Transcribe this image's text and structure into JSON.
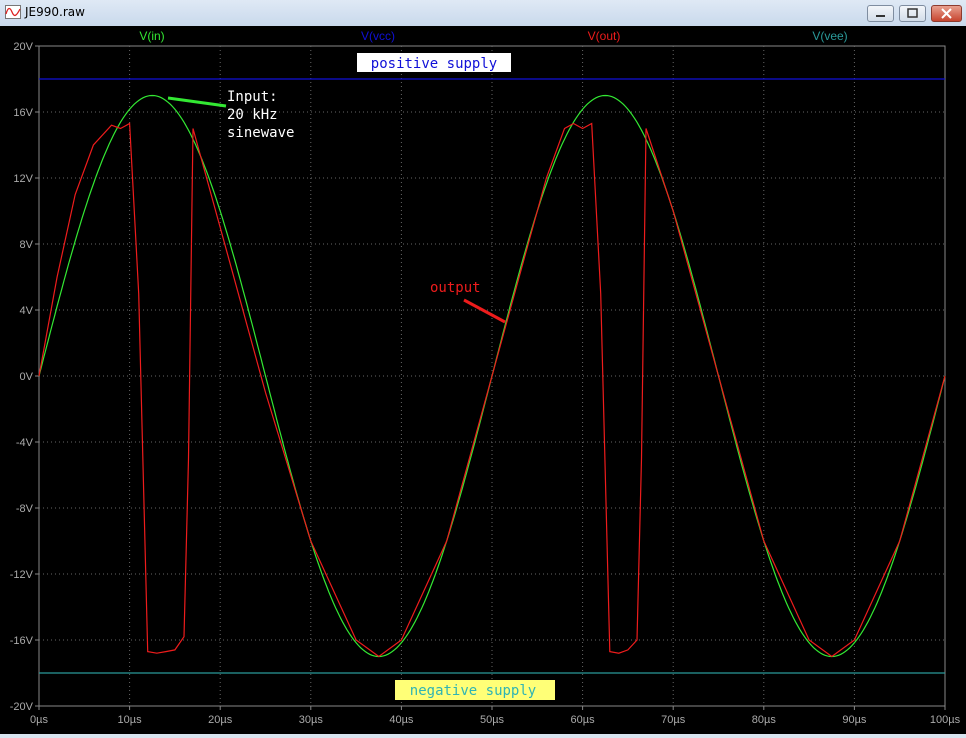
{
  "window": {
    "title": "JE990.raw"
  },
  "colors": {
    "vin": "#33e833",
    "vcc": "#1010d8",
    "vout": "#ee1c1c",
    "vee": "#2a9a9a",
    "grid": "#666666",
    "axis_text": "#aaaaaa"
  },
  "chart_data": {
    "type": "line",
    "title": "",
    "xlabel": "",
    "ylabel": "",
    "x_unit": "µs",
    "xlim": [
      0,
      100
    ],
    "ylim": [
      -20,
      20
    ],
    "x_ticks": [
      "0µs",
      "10µs",
      "20µs",
      "30µs",
      "40µs",
      "50µs",
      "60µs",
      "70µs",
      "80µs",
      "90µs",
      "100µs"
    ],
    "y_ticks": [
      "20V",
      "16V",
      "12V",
      "8V",
      "4V",
      "0V",
      "-4V",
      "-8V",
      "-12V",
      "-16V",
      "-20V"
    ],
    "grid": true,
    "legend": "top",
    "series": [
      {
        "name": "V(in)",
        "kind": "sine",
        "amplitude": 17,
        "frequency_khz": 20,
        "t_max": 100
      },
      {
        "name": "V(vcc)",
        "kind": "constant",
        "value": 18
      },
      {
        "name": "V(out)",
        "kind": "points",
        "x": [
          0,
          2,
          4,
          6,
          8,
          9,
          10,
          11,
          12,
          13,
          14,
          15,
          16,
          16.5,
          17,
          20,
          25,
          30,
          35,
          37.5,
          40,
          45,
          50,
          52,
          54,
          56,
          58,
          59,
          60,
          61,
          62,
          63,
          64,
          65,
          66,
          66.5,
          67,
          70,
          75,
          80,
          85,
          87.5,
          90,
          95,
          100
        ],
        "y": [
          0,
          6,
          11,
          14,
          15.2,
          15,
          15.3,
          5,
          -16.7,
          -16.8,
          -16.7,
          -16.6,
          -15.8,
          -5,
          15,
          9,
          -1,
          -10,
          -16,
          -17,
          -16,
          -10,
          0,
          4,
          8,
          12,
          15,
          15.3,
          15,
          15.3,
          5,
          -16.7,
          -16.8,
          -16.6,
          -16,
          -5,
          15,
          10,
          0,
          -10,
          -16,
          -17,
          -16,
          -10,
          0
        ]
      },
      {
        "name": "V(vee)",
        "kind": "constant",
        "value": -18
      }
    ],
    "annotations": {
      "positive_supply": "positive supply",
      "negative_supply": "negative supply",
      "input_line1": "Input:",
      "input_line2": "20 kHz",
      "input_line3": "sinewave",
      "output": "output"
    }
  }
}
